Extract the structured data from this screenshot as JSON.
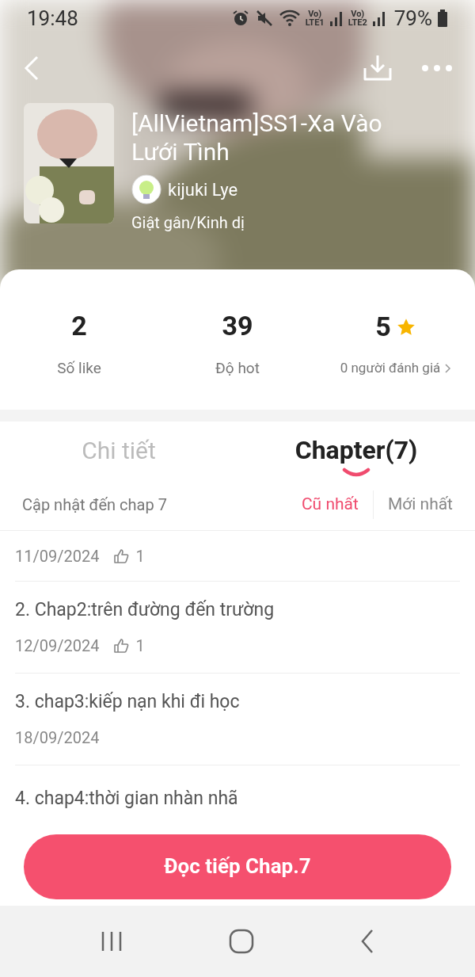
{
  "status_bar": {
    "time": "19:48",
    "volte1": "Vo)",
    "sim1": "LTE1",
    "volte2": "Vo)",
    "sim2": "LTE2",
    "battery": "79%"
  },
  "book": {
    "title": "[AllVietnam]SS1-Xa Vào Lưới Tình",
    "author": "kijuki Lye",
    "genre": "Giật gân/Kinh dị"
  },
  "stats": [
    {
      "value": "2",
      "label": "Số like"
    },
    {
      "value": "39",
      "label": "Độ hot"
    },
    {
      "value": "5",
      "label": "0 người đánh giá",
      "kind": "rating"
    }
  ],
  "tabs": [
    {
      "label": "Chi tiết",
      "selected": false
    },
    {
      "label": "Chapter(7)",
      "selected": true
    }
  ],
  "chapter_list": {
    "summary": "Cập nhật đến chap 7",
    "sort": [
      {
        "label": "Cũ nhất",
        "selected": true
      },
      {
        "label": "Mới nhất",
        "selected": false
      }
    ],
    "chapters": [
      {
        "date": "11/09/2024",
        "likes": "1"
      },
      {
        "title": "2. Chap2:trên đường đến trường",
        "date": "12/09/2024",
        "likes": "1"
      },
      {
        "title": "3. chap3:kiếp nạn khi đi học",
        "date": "18/09/2024"
      },
      {
        "title": "4. chap4:thời gian nhàn nhã"
      }
    ]
  },
  "read_button": "Đọc tiếp Chap.7"
}
